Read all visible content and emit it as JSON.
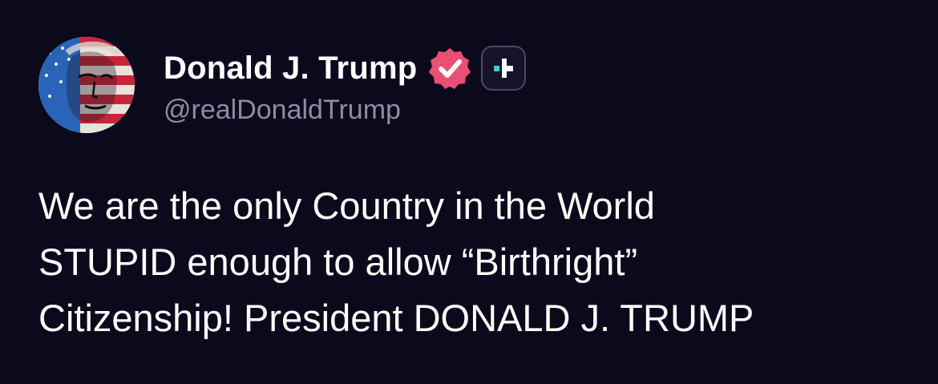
{
  "post": {
    "author": {
      "display_name": "Donald J. Trump",
      "handle": "@realDonaldTrump",
      "verified_icon": "verified-badge-icon",
      "plus_icon": "plus-badge-icon",
      "avatar": "avatar"
    },
    "text": "We are the only Country in the World\nSTUPID enough to allow “Birthright”\nCitizenship! President DONALD J. TRUMP"
  },
  "colors": {
    "background": "#0b0a1d",
    "text": "#ffffff",
    "handle": "#8d8ca1",
    "verified": "#ea4f74",
    "plus_accent": "#35d8c0"
  }
}
